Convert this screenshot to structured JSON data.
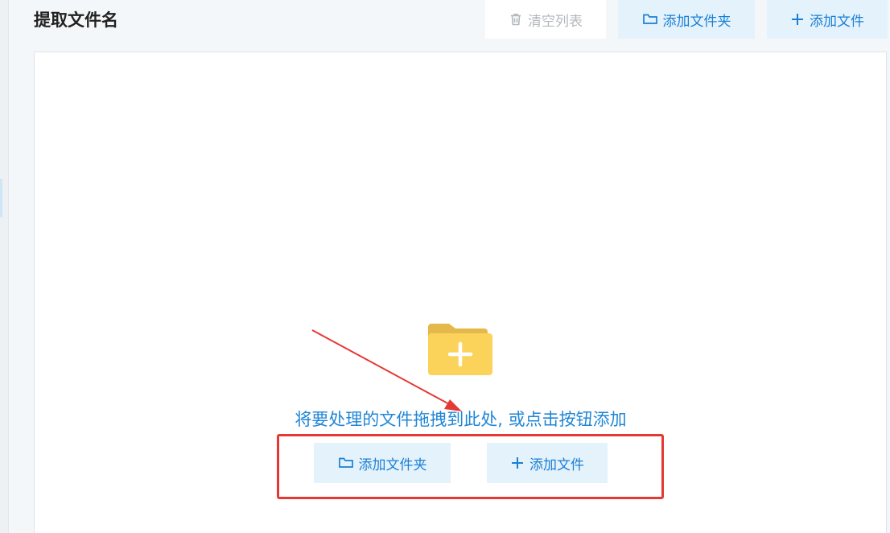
{
  "header": {
    "title": "提取文件名",
    "clear_label": "清空列表",
    "add_folder_label": "添加文件夹",
    "add_file_label": "添加文件"
  },
  "drop_zone": {
    "hint": "将要处理的文件拖拽到此处, 或点击按钮添加",
    "add_folder_label": "添加文件夹",
    "add_file_label": "添加文件"
  },
  "icons": {
    "clear": "trash-icon",
    "folder": "folder-icon",
    "add": "plus-icon",
    "drop": "folder-plus-icon"
  },
  "colors": {
    "accent": "#1a7fd4",
    "button_bg": "#e4f2fc",
    "folder_yellow": "#fcd35a",
    "annotation_red": "#e53935"
  }
}
